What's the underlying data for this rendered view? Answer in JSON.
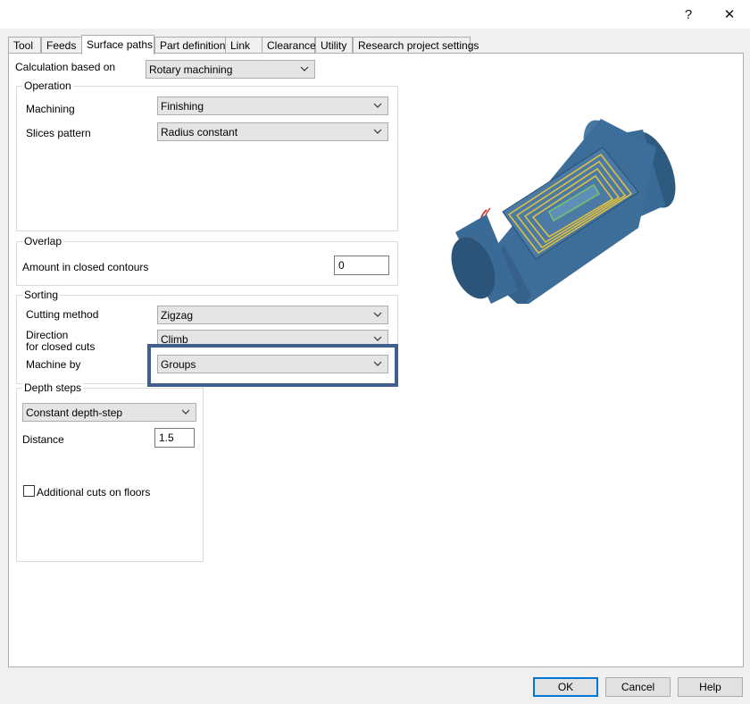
{
  "window": {
    "help_glyph": "?",
    "close_glyph": "✕"
  },
  "tabs": [
    "Tool",
    "Feeds",
    "Surface paths",
    "Part definition",
    "Link",
    "Clearance",
    "Utility",
    "Research project settings"
  ],
  "active_tab": "Surface paths",
  "calculation": {
    "label": "Calculation based on",
    "value": "Rotary machining"
  },
  "operation": {
    "title": "Operation",
    "machining_label": "Machining",
    "machining_value": "Finishing",
    "slices_label": "Slices pattern",
    "slices_value": "Radius constant"
  },
  "overlap": {
    "title": "Overlap",
    "amount_label": "Amount in closed contours",
    "amount_value": "0"
  },
  "sorting": {
    "title": "Sorting",
    "cutting_label": "Cutting method",
    "cutting_value": "Zigzag",
    "direction_label_1": "Direction",
    "direction_label_2": "for closed cuts",
    "direction_value": "Climb",
    "machine_by_label": "Machine by",
    "machine_by_value": "Groups"
  },
  "depth": {
    "title": "Depth steps",
    "mode_value": "Constant depth-step",
    "distance_label": "Distance",
    "distance_value": "1.5",
    "floors_label": "Additional cuts on floors",
    "floors_checked": false
  },
  "buttons": {
    "ok": "OK",
    "cancel": "Cancel",
    "help": "Help"
  },
  "colors": {
    "part_blue": "#3d6e9a",
    "part_dark": "#2a4f70",
    "toolpath_yellow": "#e0c040",
    "toolpath_green": "#7ac070",
    "toolpath_red": "#d04040",
    "highlight": "#3f5f8f",
    "default_button": "#0078d7"
  }
}
